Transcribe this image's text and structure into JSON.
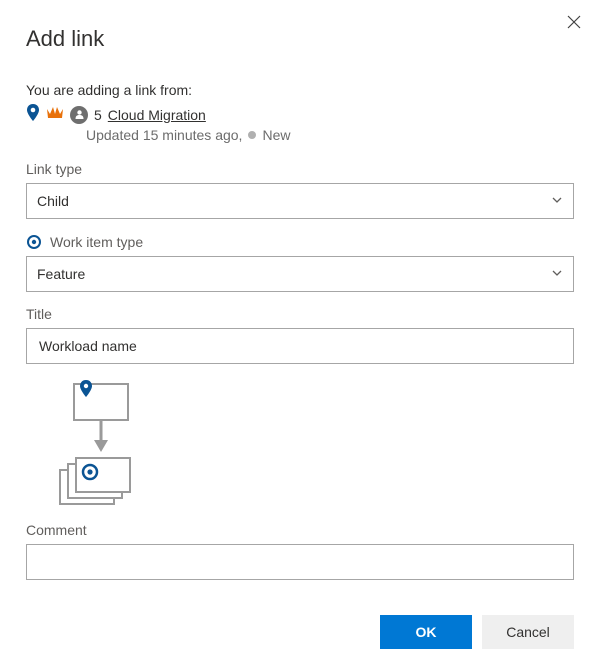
{
  "dialog": {
    "title": "Add link",
    "prompt": "You are adding a link from:"
  },
  "sourceItem": {
    "id": "5",
    "title": "Cloud Migration",
    "updated": "Updated 15 minutes ago,",
    "state": "New"
  },
  "fields": {
    "linkType": {
      "label": "Link type",
      "value": "Child"
    },
    "workItemType": {
      "label": "Work item type",
      "value": "Feature"
    },
    "title": {
      "label": "Title",
      "value": "Workload name"
    },
    "comment": {
      "label": "Comment",
      "value": ""
    }
  },
  "actions": {
    "ok": "OK",
    "cancel": "Cancel"
  }
}
